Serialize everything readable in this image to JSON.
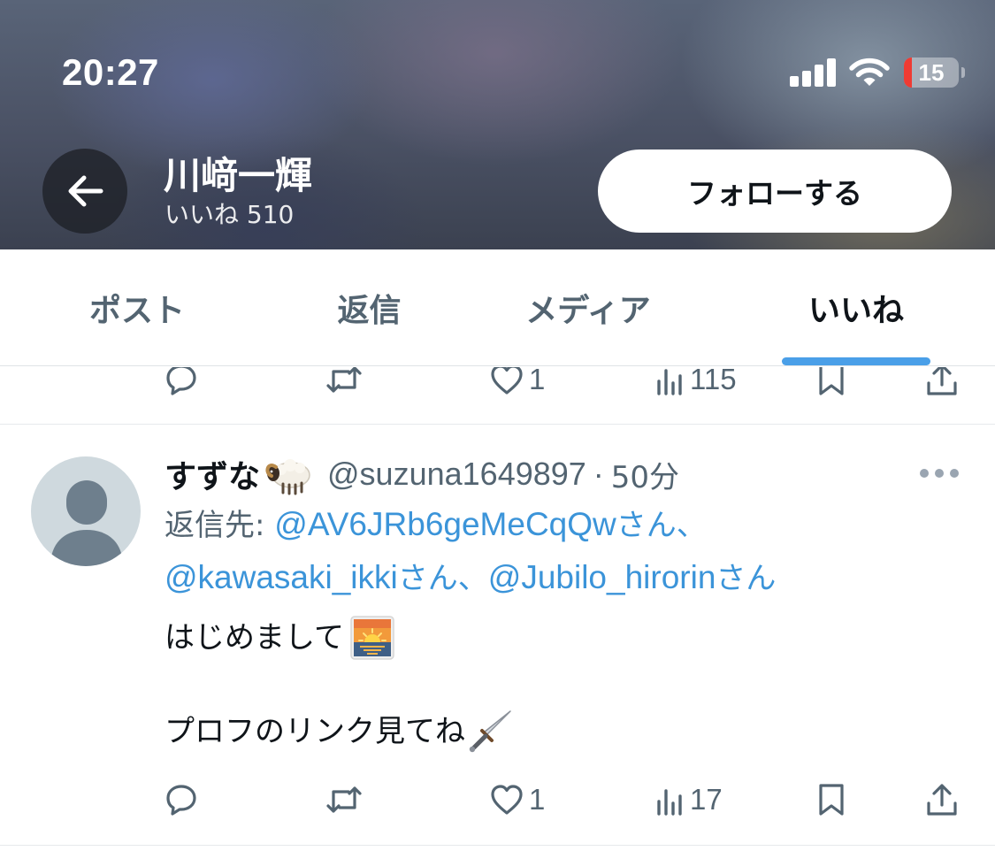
{
  "status_bar": {
    "time": "20:27",
    "battery_level": "15",
    "battery_fraction": 0.15
  },
  "header": {
    "name": "川﨑一輝",
    "likes_count": "いいね 510",
    "follow_label": "フォローする"
  },
  "tabs": [
    {
      "label": "ポスト",
      "active": false
    },
    {
      "label": "返信",
      "active": false
    },
    {
      "label": "メディア",
      "active": false
    },
    {
      "label": "いいね",
      "active": true
    }
  ],
  "previous_post_actions": {
    "like_count": "1",
    "view_count": "115"
  },
  "post": {
    "author_name": "すずな",
    "author_emoji": "ram-emoji",
    "handle": "@suzuna1649897",
    "separator": "·",
    "time": "50分",
    "reply_prefix": "返信先: ",
    "reply_to": [
      {
        "handle": "@AV6JRb6geMeCqQw",
        "suffix": "さん、"
      },
      {
        "handle": "@kawasaki_ikki",
        "suffix": "さん、"
      },
      {
        "handle": "@Jubilo_hirorin",
        "suffix": "さん"
      }
    ],
    "text_line_1": "はじめまして",
    "text_line_1_emoji": "sunrise-emoji",
    "text_line_2": "プロフのリンク見てね",
    "text_line_2_emoji": "dagger-emoji",
    "like_count": "1",
    "view_count": "17"
  },
  "colors": {
    "link": "#3b94d9",
    "muted": "#536471",
    "tab_indicator": "#4a9fe8",
    "battery_low": "#ef3b33"
  }
}
